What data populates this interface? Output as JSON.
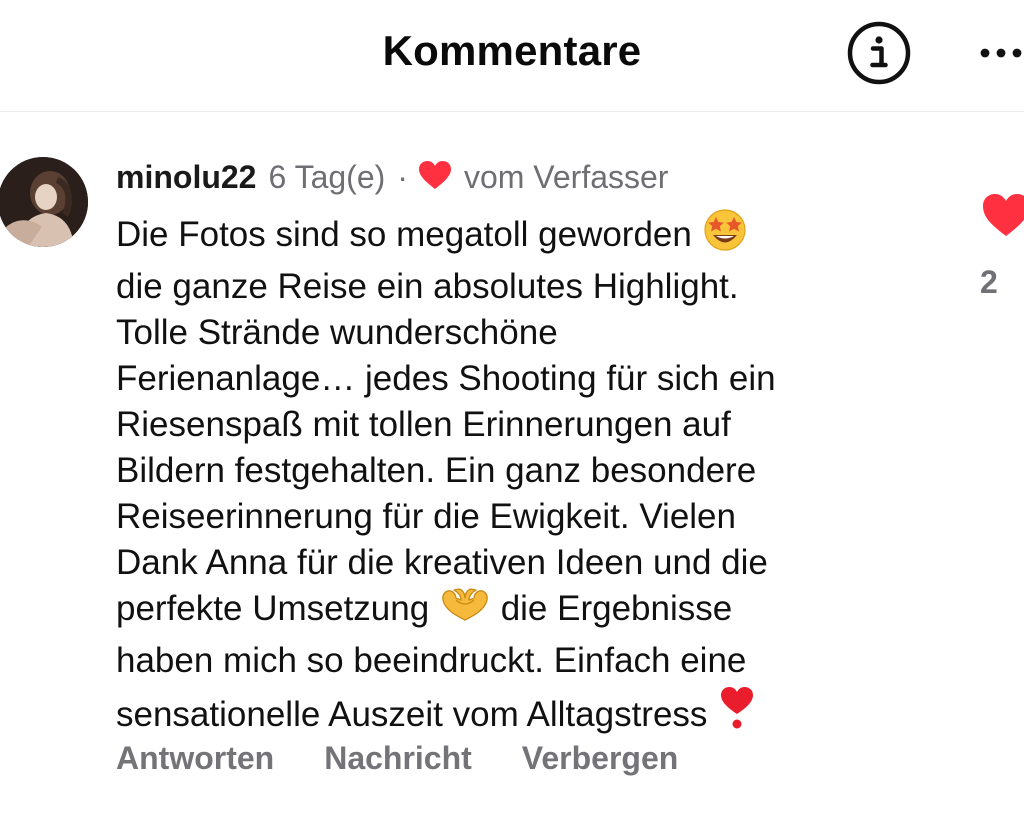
{
  "header": {
    "title": "Kommentare",
    "info_icon": "info-circle-icon",
    "more_icon": "more-horizontal-icon"
  },
  "comment": {
    "username": "minolu22",
    "time": "6 Tag(e)",
    "separator": "·",
    "liked_by_author_label": "vom Verfasser",
    "avatar": "user-avatar",
    "text_lines": [
      "Die Fotos sind so megatoll geworden",
      "die ganze Reise ein absolutes Highlight.",
      "Tolle Strände wunderschöne",
      "Ferienanlage… jedes Shooting für sich ein",
      "Riesenspaß mit tollen Erinnerungen auf",
      "Bildern festgehalten. Ein ganz besondere",
      "Reiseerinnerung für die Ewigkeit. Vielen",
      "Dank Anna für die kreativen Ideen und die",
      "perfekte Umsetzung",
      "die Ergebnisse",
      "haben mich so beeindruckt. Einfach eine",
      "sensationelle Auszeit vom Alltagstress"
    ],
    "emojis": [
      "star-struck-emoji",
      "heart-hands-emoji",
      "heart-exclamation-emoji"
    ],
    "like_count": "2",
    "liked": true
  },
  "actions": {
    "reply": "Antworten",
    "message": "Nachricht",
    "hide": "Verbergen"
  },
  "colors": {
    "heart_red": "#ff3040",
    "meta_gray": "#6e6e73",
    "action_gray": "#737378",
    "text": "#111111"
  }
}
